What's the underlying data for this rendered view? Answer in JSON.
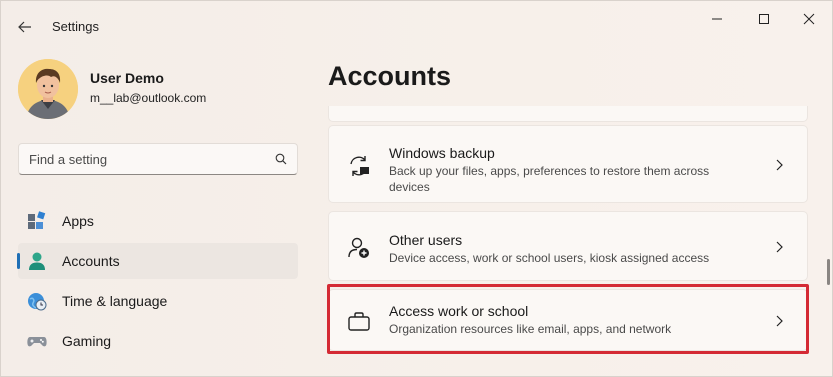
{
  "window": {
    "title": "Settings"
  },
  "profile": {
    "name": "User Demo",
    "email": "m__lab@outlook.com"
  },
  "search": {
    "placeholder": "Find a setting"
  },
  "sidebar": {
    "items": [
      {
        "label": "Apps",
        "icon": "apps-icon",
        "active": false
      },
      {
        "label": "Accounts",
        "icon": "accounts-icon",
        "active": true
      },
      {
        "label": "Time & language",
        "icon": "time-language-icon",
        "active": false
      },
      {
        "label": "Gaming",
        "icon": "gaming-icon",
        "active": false
      }
    ]
  },
  "main": {
    "title": "Accounts",
    "cards": [
      {
        "title": "Windows backup",
        "description": "Back up your files, apps, preferences to restore them across devices",
        "icon": "backup-icon"
      },
      {
        "title": "Other users",
        "description": "Device access, work or school users, kiosk assigned access",
        "icon": "other-users-icon"
      },
      {
        "title": "Access work or school",
        "description": "Organization resources like email, apps, and network",
        "icon": "briefcase-icon"
      }
    ]
  },
  "colors": {
    "accent": "#1f6fb5",
    "highlight": "#d42a34"
  }
}
